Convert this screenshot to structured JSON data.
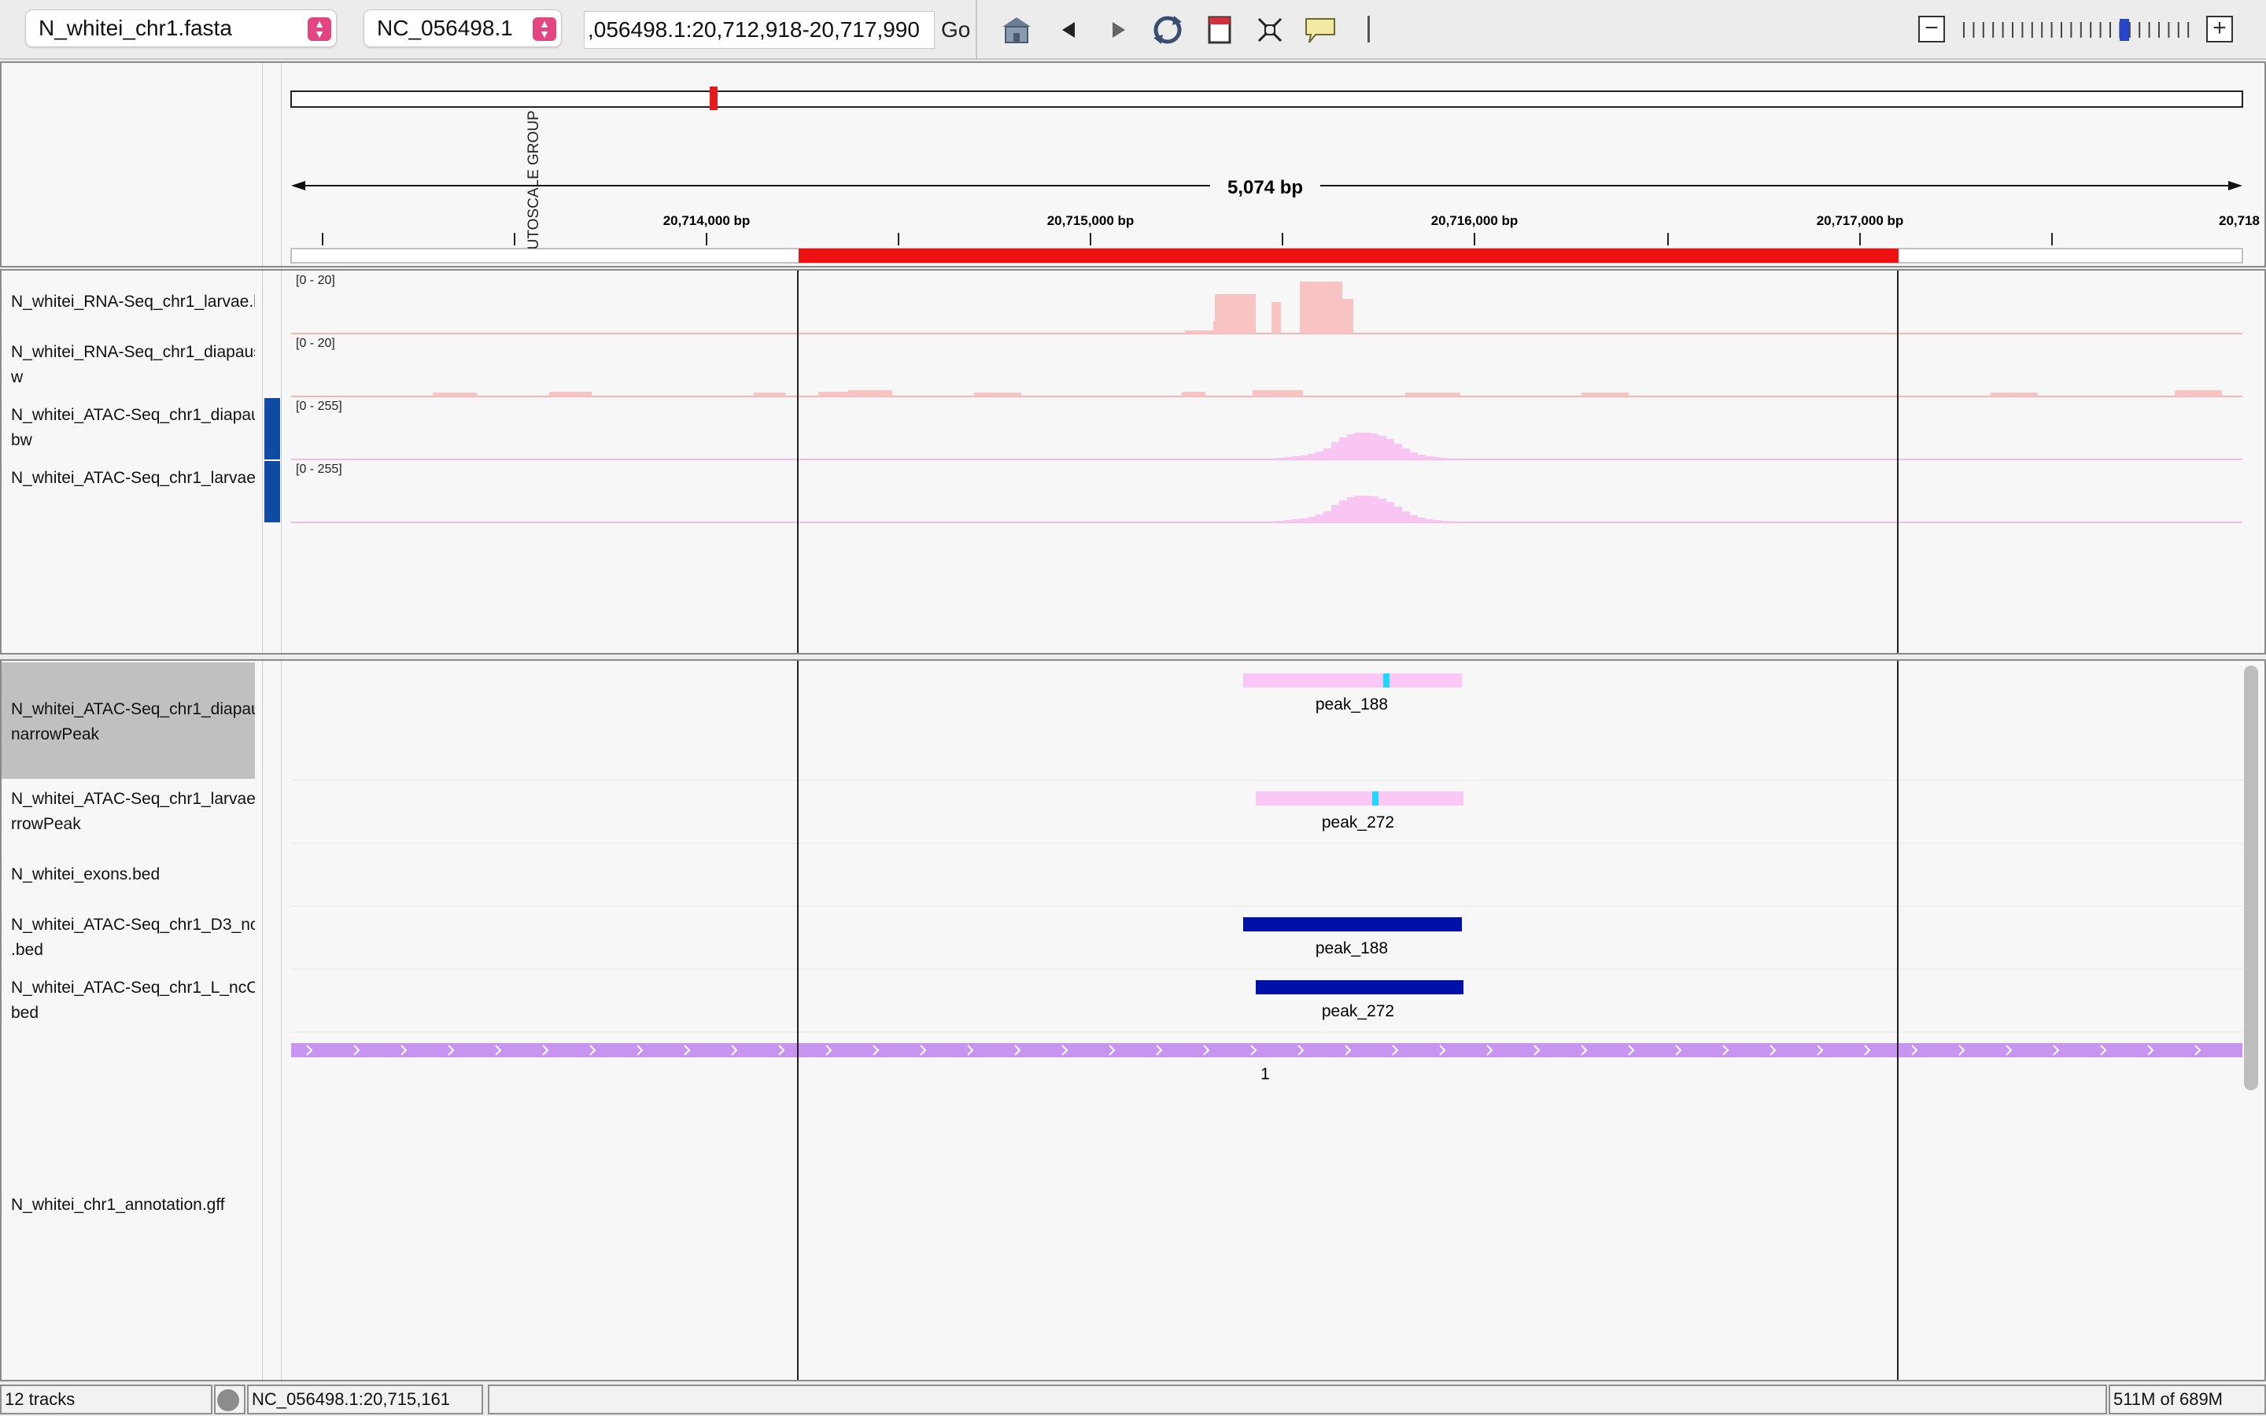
{
  "toolbar": {
    "genome": "N_whitei_chr1.fasta",
    "chromosome": "NC_056498.1",
    "locus": ",056498.1:20,712,918-20,717,990",
    "go_label": "Go",
    "icons": [
      "home-icon",
      "back-arrow-icon",
      "forward-arrow-icon",
      "refresh-icon",
      "region-of-interest-icon",
      "resize-to-window-icon",
      "popup-text-icon"
    ]
  },
  "ruler": {
    "autoscale_label": "AUTOSCALE GROUP",
    "span_label": "5,074 bp",
    "tick_labels": [
      "20,714,000 bp",
      "20,715,000 bp",
      "20,716,000 bp",
      "20,717,000 bp",
      "20,718"
    ]
  },
  "data_tracks": [
    {
      "name": "N_whitei_RNA-Seq_chr1_larvae.b",
      "range": "[0 - 20]",
      "color": "#f8c3c3"
    },
    {
      "name": "N_whitei_RNA-Seq_chr1_diapaus\nw",
      "range": "[0 - 20]",
      "color": "#f8c3c3"
    },
    {
      "name": "N_whitei_ATAC-Seq_chr1_diapau\nbw",
      "range": "[0 - 255]",
      "color": "#f9c6f3"
    },
    {
      "name": "N_whitei_ATAC-Seq_chr1_larvae",
      "range": "[0 - 255]",
      "color": "#f9c6f3"
    }
  ],
  "feature_tracks": [
    {
      "name": "N_whitei_ATAC-Seq_chr1_diapau\nnarrowPeak",
      "feature_label": "peak_188"
    },
    {
      "name": "N_whitei_ATAC-Seq_chr1_larvae\nrrowPeak",
      "feature_label": "peak_272"
    },
    {
      "name": "N_whitei_exons.bed",
      "feature_label": ""
    },
    {
      "name": "N_whitei_ATAC-Seq_chr1_D3_nc\n.bed",
      "feature_label": "peak_188"
    },
    {
      "name": "N_whitei_ATAC-Seq_chr1_L_ncC\nbed",
      "feature_label": "peak_272"
    },
    {
      "name": "N_whitei_chr1_annotation.gff",
      "feature_label": "1"
    }
  ],
  "status": {
    "track_count": "12 tracks",
    "position": "NC_056498.1:20,715,161",
    "memory": "511M of 689M"
  },
  "colors": {
    "roi": "#ee1111",
    "narrowpeak": "#fbc7f7",
    "summit": "#1fd6ff",
    "bed": "#0010a8",
    "gff": "#c794f0"
  }
}
